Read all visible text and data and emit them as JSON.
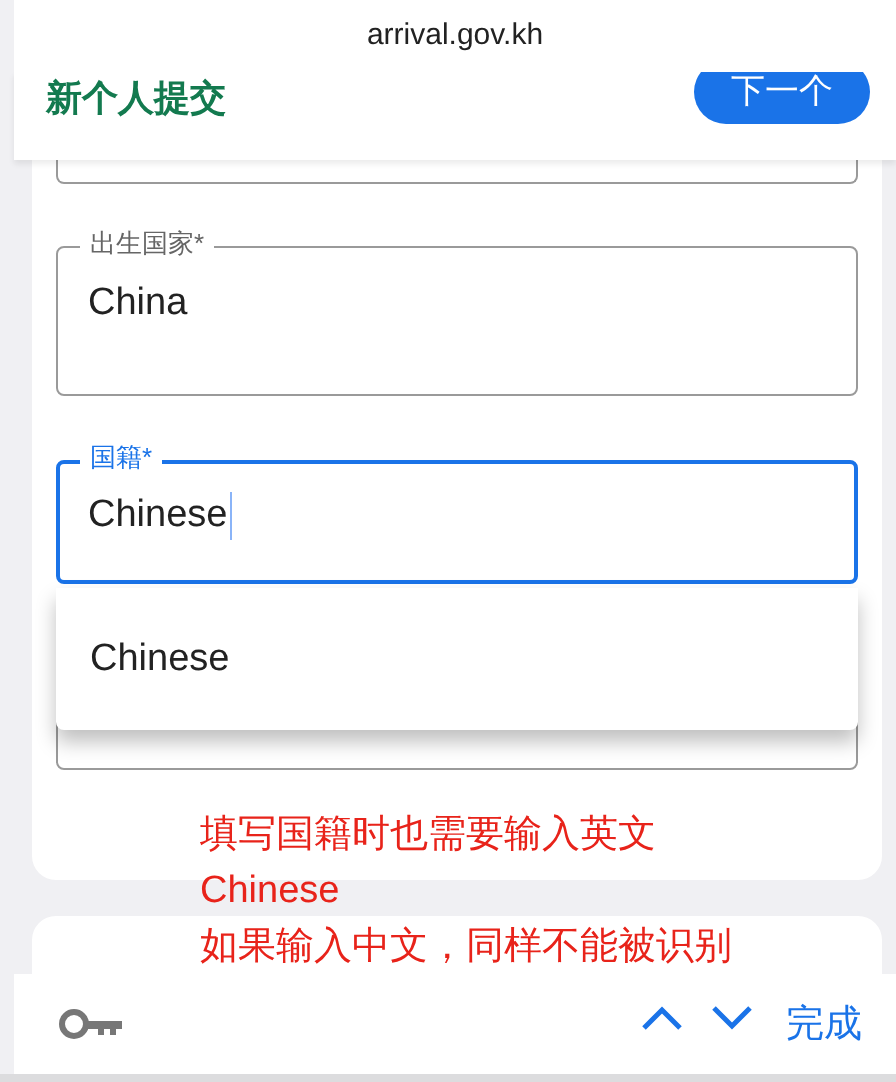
{
  "address_bar": {
    "url": "arrival.gov.kh"
  },
  "header": {
    "title": "新个人提交",
    "next_button": "下一个"
  },
  "fields": [
    {
      "label": "出生国家*",
      "value": "China",
      "focused": false
    },
    {
      "label": "国籍*",
      "value": "Chinese",
      "focused": true
    }
  ],
  "autocomplete": {
    "options": [
      "Chinese"
    ]
  },
  "annotation": {
    "lines": [
      "填写国籍时也需要输入英文",
      "Chinese",
      "如果输入中文，同样不能被识别"
    ]
  },
  "keyboard_toolbar": {
    "done": "完成"
  }
}
